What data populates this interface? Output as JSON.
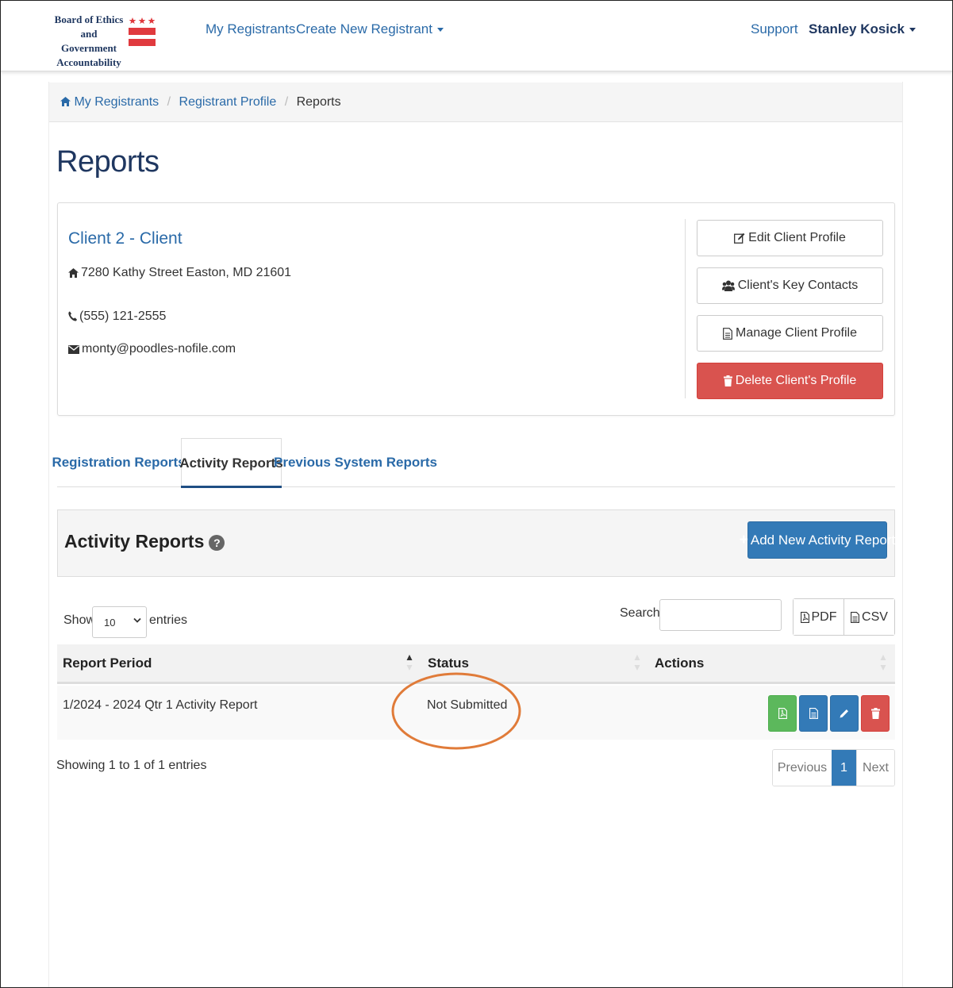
{
  "header": {
    "logo_lines": [
      "Board of Ethics",
      "and Government",
      "Accountability"
    ],
    "nav": {
      "my_registrants": "My Registrants",
      "create_new_registrant": "Create New Registrant",
      "support": "Support",
      "user_name": "Stanley Kosick"
    }
  },
  "breadcrumb": {
    "home": "My Registrants",
    "profile": "Registrant Profile",
    "current": "Reports",
    "separator": "/"
  },
  "page": {
    "title": "Reports"
  },
  "client": {
    "name": "Client 2 - Client",
    "address": "7280 Kathy Street Easton, MD 21601",
    "phone": "(555) 121-2555",
    "email": "monty@poodles-nofile.com",
    "buttons": {
      "edit": "Edit Client Profile",
      "contacts": "Client's Key Contacts",
      "manage": "Manage Client Profile",
      "delete": "Delete Client's Profile"
    }
  },
  "tabs": [
    {
      "label": "Registration Reports",
      "active": false
    },
    {
      "label": "Activity Reports",
      "active": true
    },
    {
      "label": "Previous System Reports",
      "active": false
    }
  ],
  "panel": {
    "title": "Activity Reports",
    "help_glyph": "?",
    "add_button": "Add New Activity Report"
  },
  "table_controls": {
    "show_label": "Show",
    "page_size": "10",
    "entries_label": "entries",
    "search_label": "Search:",
    "search_value": "",
    "export_pdf": "PDF",
    "export_csv": "CSV"
  },
  "table": {
    "columns": [
      "Report Period",
      "Status",
      "Actions"
    ],
    "rows": [
      {
        "report_period": "1/2024 - 2024 Qtr 1 Activity Report",
        "status": "Not Submitted"
      }
    ]
  },
  "footer": {
    "showing": "Showing 1 to 1 of 1 entries",
    "previous": "Previous",
    "current_page": "1",
    "next": "Next"
  },
  "colors": {
    "brand_navy": "#1f3760",
    "link_blue": "#2a6aa8",
    "primary": "#337ab7",
    "danger": "#d9534f",
    "success": "#5cb85c",
    "highlight_ring": "#e07b39",
    "flag_red": "#e03a3e"
  },
  "icons": {
    "home": "home-icon",
    "address": "home-icon",
    "phone": "phone-icon",
    "email": "envelope-icon",
    "edit": "edit-icon",
    "contacts": "users-icon",
    "manage": "file-icon",
    "delete": "trash-icon",
    "help": "question-circle-icon",
    "pdf": "file-pdf-icon",
    "csv": "file-text-icon",
    "row_actions": [
      "file-pdf-icon",
      "file-text-icon",
      "pencil-icon",
      "trash-icon"
    ]
  }
}
